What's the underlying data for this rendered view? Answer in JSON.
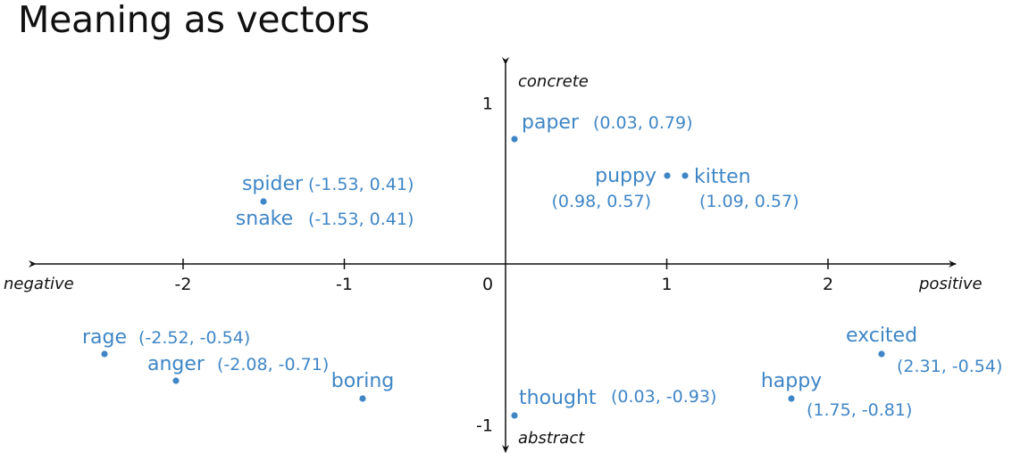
{
  "page": {
    "title": "Meaning as vectors"
  },
  "chart_data": {
    "type": "scatter",
    "title": "Meaning as vectors",
    "xlabel_negative": "negative",
    "xlabel_positive": "positive",
    "ylabel_positive": "concrete",
    "ylabel_negative": "abstract",
    "xlim": [
      -3,
      2.8
    ],
    "ylim": [
      -1.1,
      1.3
    ],
    "grid": false,
    "legend": "none",
    "x_ticks": [
      {
        "value": -2,
        "label": "-2"
      },
      {
        "value": -1,
        "label": "-1"
      },
      {
        "value": 0,
        "label": "0"
      },
      {
        "value": 1,
        "label": "1"
      },
      {
        "value": 2,
        "label": "2"
      }
    ],
    "y_ticks": [
      {
        "value": 1,
        "label": "1"
      },
      {
        "value": -1,
        "label": "-1"
      }
    ],
    "point_color": "#3f86c6",
    "points": [
      {
        "word": "paper",
        "x": 0.03,
        "y": 0.79,
        "coord_label": "(0.03, 0.79)"
      },
      {
        "word": "spider",
        "x": -1.53,
        "y": 0.41,
        "coord_label": "(-1.53, 0.41)"
      },
      {
        "word": "snake",
        "x": -1.53,
        "y": 0.41,
        "coord_label": "(-1.53, 0.41)"
      },
      {
        "word": "puppy",
        "x": 0.98,
        "y": 0.57,
        "coord_label": "(0.98, 0.57)"
      },
      {
        "word": "kitten",
        "x": 1.09,
        "y": 0.57,
        "coord_label": "(1.09, 0.57)"
      },
      {
        "word": "rage",
        "x": -2.52,
        "y": -0.54,
        "coord_label": "(-2.52, -0.54)"
      },
      {
        "word": "anger",
        "x": -2.08,
        "y": -0.71,
        "coord_label": "(-2.08, -0.71)"
      },
      {
        "word": "boring",
        "x": -0.9,
        "y": -0.83,
        "coord_label": ""
      },
      {
        "word": "thought",
        "x": 0.03,
        "y": -0.93,
        "coord_label": "(0.03, -0.93)"
      },
      {
        "word": "excited",
        "x": 2.31,
        "y": -0.54,
        "coord_label": "(2.31, -0.54)"
      },
      {
        "word": "happy",
        "x": 1.75,
        "y": -0.81,
        "coord_label": "(1.75, -0.81)"
      }
    ]
  }
}
